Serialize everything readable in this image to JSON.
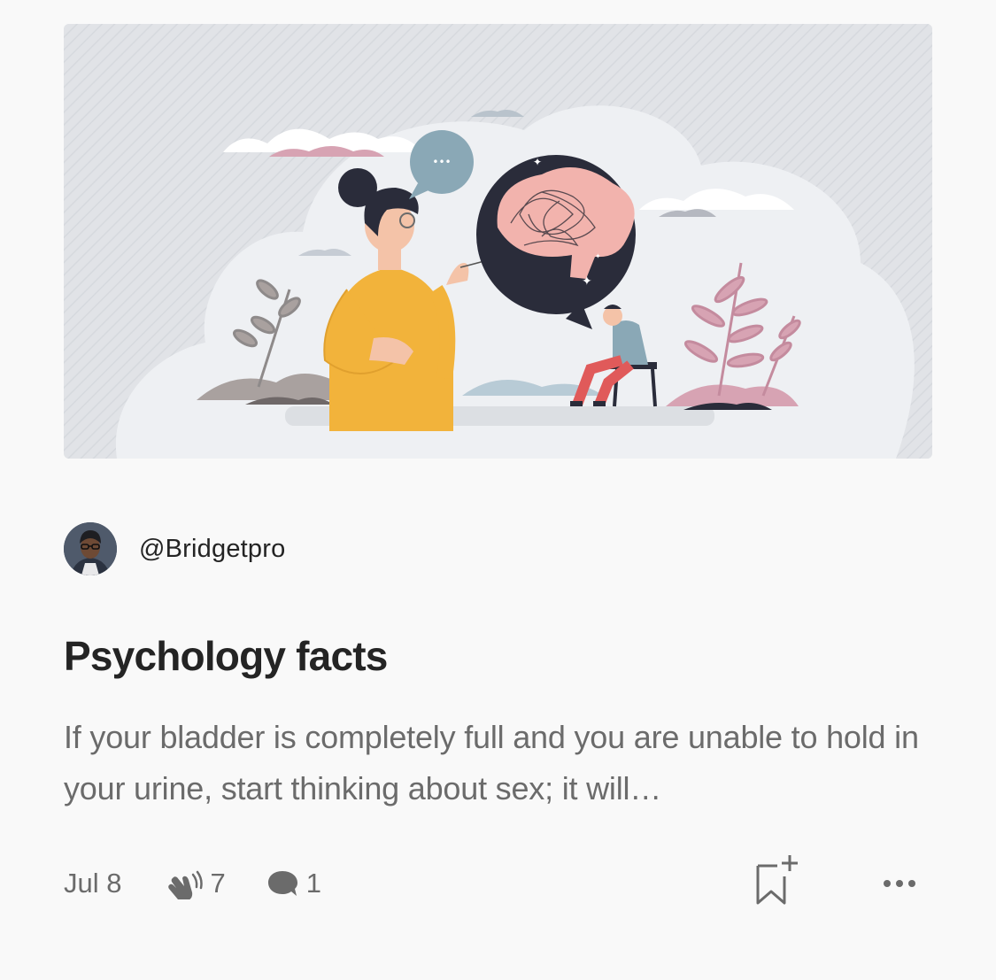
{
  "article": {
    "hero_image": "psychology-illustration",
    "author": {
      "handle": "@Bridgetpro",
      "avatar": "author-avatar"
    },
    "title": "Psychology facts",
    "excerpt": "If your bladder is completely full and you are unable to hold in your urine, start thinking about sex; it will…",
    "date": "Jul 8",
    "claps": "7",
    "responses": "1"
  },
  "icons": {
    "claps": "clap-icon",
    "responses": "comment-icon",
    "save": "bookmark-add-icon",
    "more": "more-options-icon"
  },
  "colors": {
    "text": "#242424",
    "secondary_text": "#6b6b6b",
    "background": "#f9f9f9"
  }
}
